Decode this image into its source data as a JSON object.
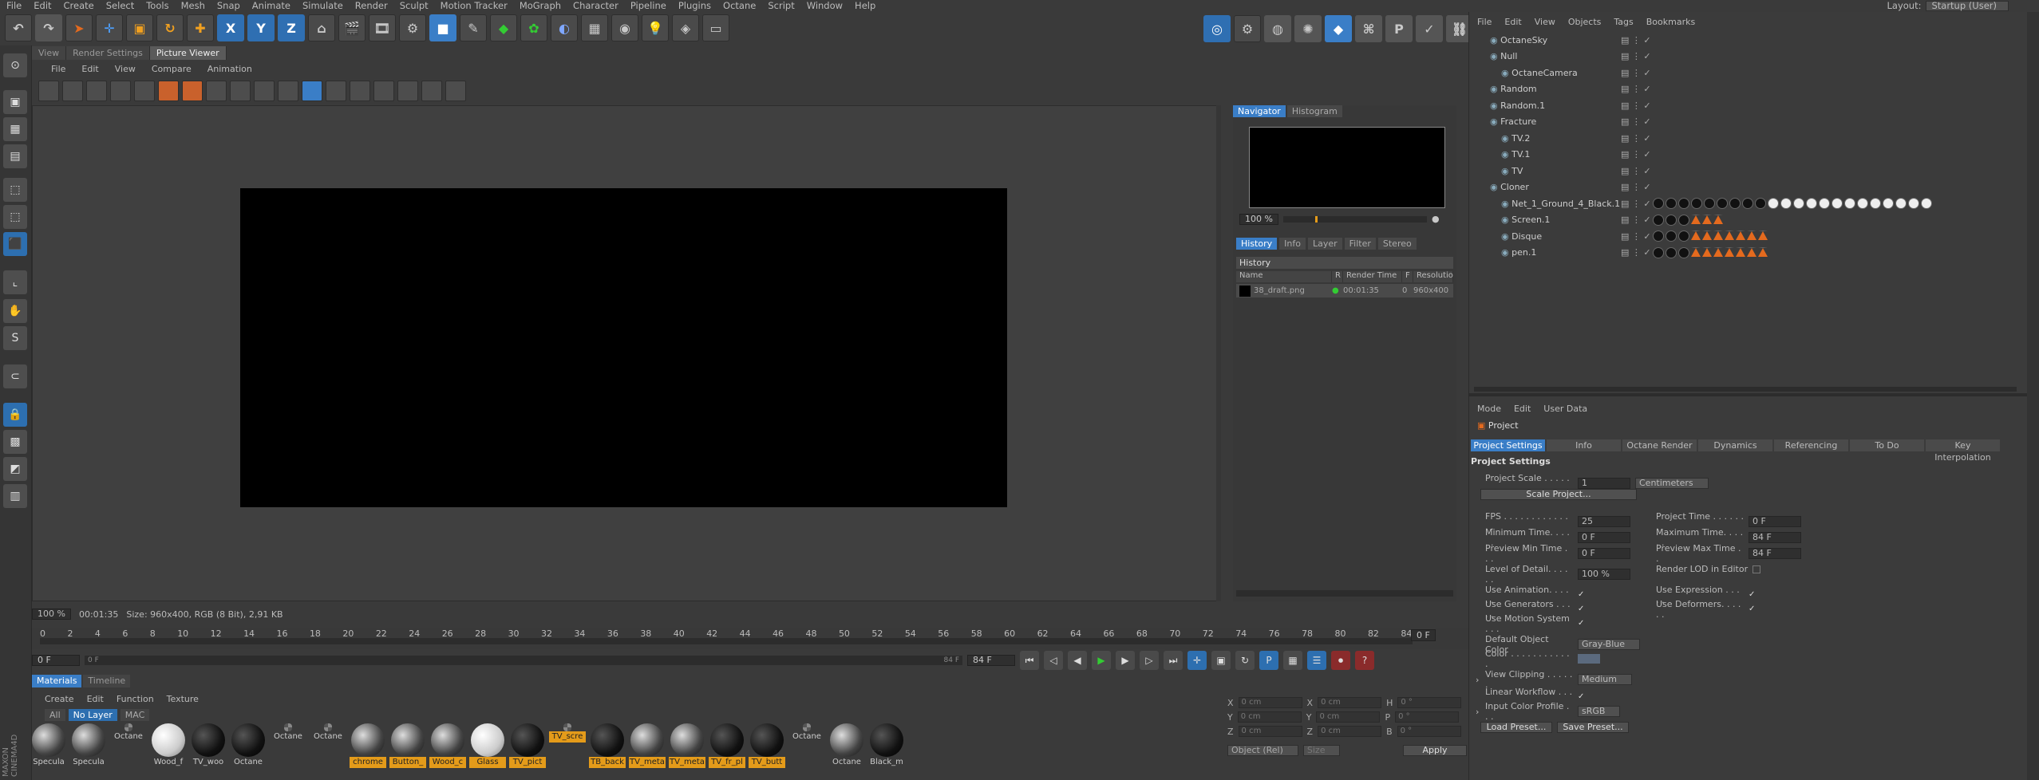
{
  "menubar": [
    "File",
    "Edit",
    "Create",
    "Select",
    "Tools",
    "Mesh",
    "Snap",
    "Animate",
    "Simulate",
    "Render",
    "Sculpt",
    "Motion Tracker",
    "MoGraph",
    "Character",
    "Pipeline",
    "Plugins",
    "Octane",
    "Script",
    "Window",
    "Help"
  ],
  "layout": {
    "label": "Layout:",
    "value": "Startup (User)"
  },
  "viewer_tabs": [
    "View",
    "Render Settings",
    "Picture Viewer"
  ],
  "pv_menu": [
    "File",
    "Edit",
    "View",
    "Compare",
    "Animation"
  ],
  "status": {
    "zoom": "100 %",
    "time": "00:01:35",
    "info": "Size: 960x400, RGB (8 Bit), 2,91 KB"
  },
  "navigator": {
    "tabs": [
      "Navigator",
      "Histogram"
    ],
    "zoom": "100 %"
  },
  "history": {
    "tabs": [
      "History",
      "Info",
      "Layer",
      "Filter",
      "Stereo"
    ],
    "title": "History",
    "cols": [
      "Name",
      "R",
      "Render Time",
      "F",
      "Resolutio"
    ],
    "row": {
      "name": "38_draft.png",
      "time": "00:01:35",
      "f": "0",
      "res": "960x400"
    }
  },
  "timeline": {
    "ticks": [
      "0",
      "2",
      "4",
      "6",
      "8",
      "10",
      "12",
      "14",
      "16",
      "18",
      "20",
      "22",
      "24",
      "26",
      "28",
      "30",
      "32",
      "34",
      "36",
      "38",
      "40",
      "42",
      "44",
      "46",
      "48",
      "50",
      "52",
      "54",
      "56",
      "58",
      "60",
      "62",
      "64",
      "66",
      "68",
      "70",
      "72",
      "74",
      "76",
      "78",
      "80",
      "82",
      "84"
    ],
    "start": "0 F",
    "current": "0 F",
    "end": "84 F",
    "end2": "84 F",
    "right": "0 F"
  },
  "materials": {
    "tabs": [
      "Materials",
      "Timeline"
    ],
    "menu": [
      "Create",
      "Edit",
      "Function",
      "Texture"
    ],
    "filters": [
      "All",
      "No Layer",
      "MAC"
    ],
    "items": [
      {
        "label": "Specula",
        "hl": false,
        "kind": "grey"
      },
      {
        "label": "Specula",
        "hl": false,
        "kind": "grey"
      },
      {
        "label": "Octane",
        "hl": false,
        "kind": "chk"
      },
      {
        "label": "Wood_f",
        "hl": false,
        "kind": "white"
      },
      {
        "label": "TV_woo",
        "hl": false,
        "kind": "dark"
      },
      {
        "label": "Octane",
        "hl": false,
        "kind": "dark"
      },
      {
        "label": "Octane",
        "hl": false,
        "kind": "chk"
      },
      {
        "label": "Octane",
        "hl": false,
        "kind": "chk"
      },
      {
        "label": "chrome",
        "hl": true,
        "kind": "grey"
      },
      {
        "label": "Button_",
        "hl": true,
        "kind": "grey"
      },
      {
        "label": "Wood_c",
        "hl": true,
        "kind": "grey"
      },
      {
        "label": "Glass",
        "hl": true,
        "kind": "white"
      },
      {
        "label": "TV_pict",
        "hl": true,
        "kind": "dark"
      },
      {
        "label": "TV_scre",
        "hl": true,
        "kind": "chk"
      },
      {
        "label": "TB_back",
        "hl": true,
        "kind": "dark"
      },
      {
        "label": "TV_meta",
        "hl": true,
        "kind": "grey"
      },
      {
        "label": "TV_meta",
        "hl": true,
        "kind": "grey"
      },
      {
        "label": "TV_fr_pl",
        "hl": true,
        "kind": "dark"
      },
      {
        "label": "TV_butt",
        "hl": true,
        "kind": "dark"
      },
      {
        "label": "Octane",
        "hl": false,
        "kind": "chk"
      },
      {
        "label": "Octane",
        "hl": false,
        "kind": "grey"
      },
      {
        "label": "Black_m",
        "hl": false,
        "kind": "dark"
      }
    ]
  },
  "coords": {
    "rows": [
      [
        "X",
        "0 cm",
        "X",
        "0 cm",
        "H",
        "0 °"
      ],
      [
        "Y",
        "0 cm",
        "Y",
        "0 cm",
        "P",
        "0 °"
      ],
      [
        "Z",
        "0 cm",
        "Z",
        "0 cm",
        "B",
        "0 °"
      ]
    ],
    "mode": "Object (Rel)",
    "size": "Size",
    "apply": "Apply"
  },
  "objects": {
    "menu": [
      "File",
      "Edit",
      "View",
      "Objects",
      "Tags",
      "Bookmarks"
    ],
    "rows": [
      {
        "name": "OctaneSky",
        "indent": 0
      },
      {
        "name": "Null",
        "indent": 0
      },
      {
        "name": "OctaneCamera",
        "indent": 1
      },
      {
        "name": "Random",
        "indent": 0
      },
      {
        "name": "Random.1",
        "indent": 0
      },
      {
        "name": "Fracture",
        "indent": 0
      },
      {
        "name": "TV.2",
        "indent": 1
      },
      {
        "name": "TV.1",
        "indent": 1
      },
      {
        "name": "TV",
        "indent": 1
      },
      {
        "name": "Cloner",
        "indent": 0
      },
      {
        "name": "Net_1_Ground_4_Black.1",
        "indent": 1
      },
      {
        "name": "Screen.1",
        "indent": 1
      },
      {
        "name": "Disque",
        "indent": 1
      },
      {
        "name": "pen.1",
        "indent": 1
      }
    ]
  },
  "attributes": {
    "menu": [
      "Mode",
      "Edit",
      "User Data"
    ],
    "title": "Project",
    "tabs": [
      "Project Settings",
      "Info",
      "Octane Render",
      "Dynamics",
      "Referencing",
      "To Do",
      "Key Interpolation"
    ],
    "section": "Project Settings",
    "scale_label": "Project Scale . . . . . .",
    "scale_value": "1",
    "scale_unit": "Centimeters",
    "scale_btn": "Scale Project...",
    "fps_label": "FPS . . . . . . . . . . . . . .",
    "fps": "25",
    "ptime_label": "Project Time . . . . . . .",
    "ptime": "0 F",
    "mintime_label": "Minimum Time. . . . . .",
    "mintime": "0 F",
    "maxtime_label": "Maximum Time. . . . . .",
    "maxtime": "84 F",
    "pmin_label": "Preview Min Time . . .",
    "pmin": "0 F",
    "pmax_label": "Preview Max Time . .",
    "pmax": "84 F",
    "lod_label": "Level of Detail. . . . . .",
    "lod": "100 %",
    "lodr_label": "Render LOD in Editor",
    "useanim": "Use Animation. . . . . .",
    "useexpr": "Use Expression . . . . .",
    "usegen": "Use Generators . . . . .",
    "usedef": "Use Deformers. . . . . .",
    "usemot": "Use Motion System . . .",
    "defcol_label": "Default Object Color",
    "defcol": "Gray-Blue",
    "color_label": "Color . . . . . . . . . . . .",
    "clip_label": "View Clipping . . . . . .",
    "clip": "Medium",
    "lin_label": "Linear Workflow . . . .",
    "icp_label": "Input Color Profile . . .",
    "icp": "sRGB",
    "load": "Load Preset...",
    "save": "Save Preset..."
  },
  "watermark": "MAXON CINEMA4D",
  "colors": {
    "accent": "#3a7ec7",
    "orange": "#e49b1a"
  }
}
